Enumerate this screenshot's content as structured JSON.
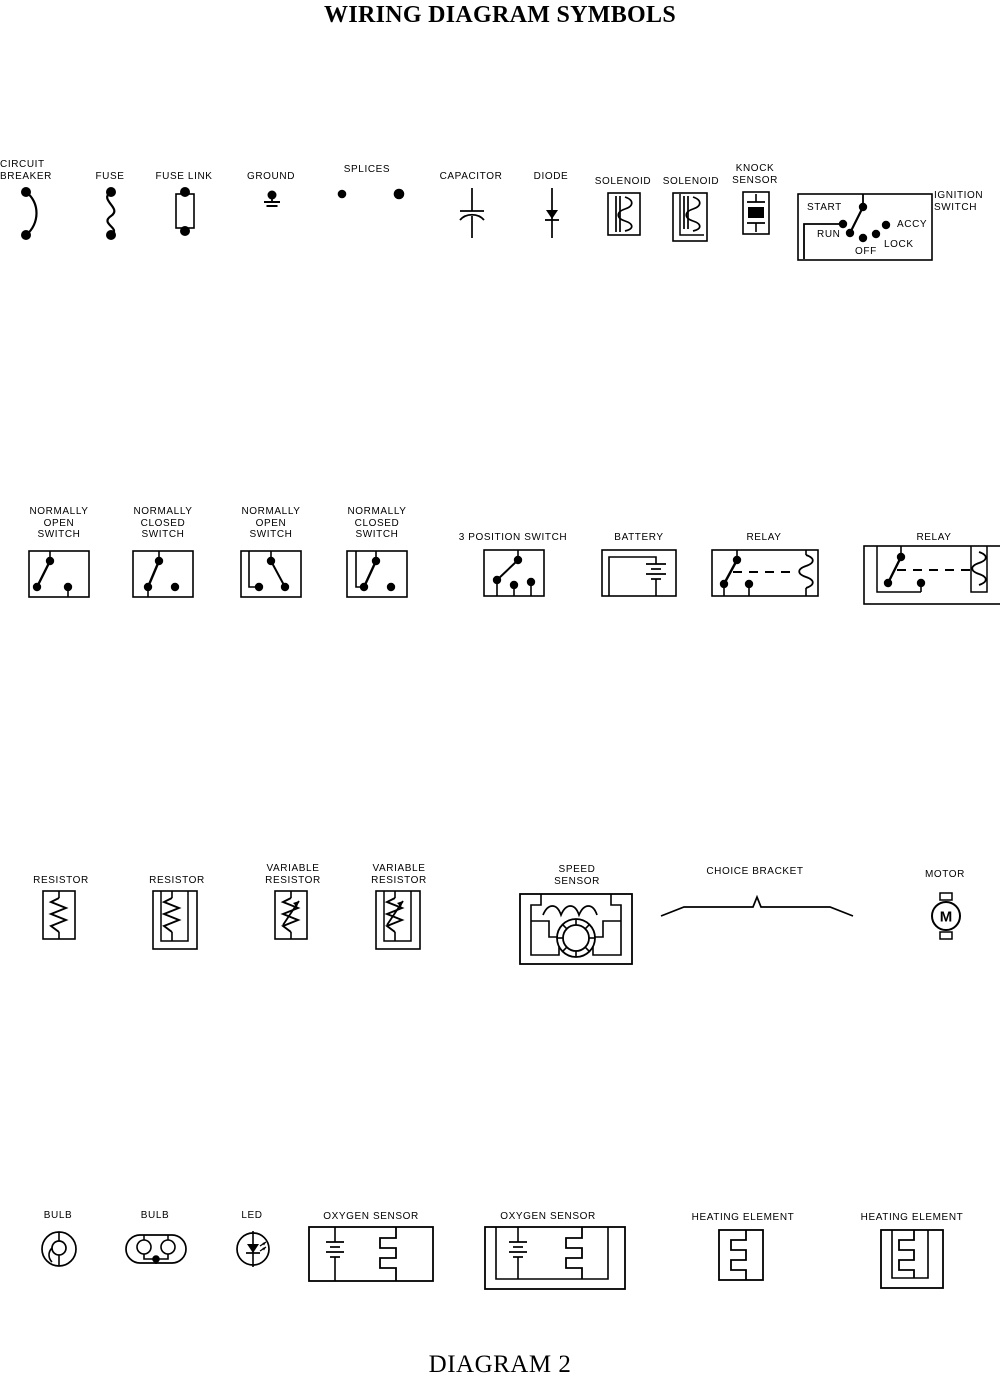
{
  "document": {
    "title": "WIRING DIAGRAM SYMBOLS",
    "footer": "DIAGRAM 2",
    "ink_color": "#000000",
    "background_color": "#ffffff"
  },
  "rows": {
    "row1": {
      "symbols": [
        {
          "name": "circuit-breaker",
          "label": "CIRCUIT\nBREAKER"
        },
        {
          "name": "fuse",
          "label": "FUSE"
        },
        {
          "name": "fuse-link",
          "label": "FUSE LINK"
        },
        {
          "name": "ground",
          "label": "GROUND"
        },
        {
          "name": "splices",
          "label": "SPLICES"
        },
        {
          "name": "capacitor",
          "label": "CAPACITOR"
        },
        {
          "name": "diode",
          "label": "DIODE"
        },
        {
          "name": "solenoid-a",
          "label": "SOLENOID"
        },
        {
          "name": "solenoid-b",
          "label": "SOLENOID"
        },
        {
          "name": "knock-sensor",
          "label": "KNOCK\nSENSOR"
        },
        {
          "name": "ignition-switch",
          "label": "IGNITION\nSWITCH"
        }
      ],
      "ignition_switch_positions": [
        "START",
        "RUN",
        "OFF",
        "LOCK",
        "ACCY"
      ]
    },
    "row2": {
      "symbols": [
        {
          "name": "normally-open-switch-1",
          "label": "NORMALLY\nOPEN\nSWITCH"
        },
        {
          "name": "normally-closed-switch-1",
          "label": "NORMALLY\nCLOSED\nSWITCH"
        },
        {
          "name": "normally-open-switch-2",
          "label": "NORMALLY\nOPEN\nSWITCH"
        },
        {
          "name": "normally-closed-switch-2",
          "label": "NORMALLY\nCLOSED\nSWITCH"
        },
        {
          "name": "three-position-switch",
          "label": "3 POSITION SWITCH"
        },
        {
          "name": "battery",
          "label": "BATTERY"
        },
        {
          "name": "relay-1",
          "label": "RELAY"
        },
        {
          "name": "relay-2",
          "label": "RELAY"
        }
      ]
    },
    "row3": {
      "symbols": [
        {
          "name": "resistor-1",
          "label": "RESISTOR"
        },
        {
          "name": "resistor-2",
          "label": "RESISTOR"
        },
        {
          "name": "variable-resistor-1",
          "label": "VARIABLE\nRESISTOR"
        },
        {
          "name": "variable-resistor-2",
          "label": "VARIABLE\nRESISTOR"
        },
        {
          "name": "speed-sensor",
          "label": "SPEED\nSENSOR"
        },
        {
          "name": "choice-bracket",
          "label": "CHOICE BRACKET"
        },
        {
          "name": "motor",
          "label": "MOTOR",
          "glyph": "M"
        }
      ]
    },
    "row4": {
      "symbols": [
        {
          "name": "bulb-1",
          "label": "BULB"
        },
        {
          "name": "bulb-2",
          "label": "BULB"
        },
        {
          "name": "led",
          "label": "LED"
        },
        {
          "name": "oxygen-sensor-1",
          "label": "OXYGEN SENSOR"
        },
        {
          "name": "oxygen-sensor-2",
          "label": "OXYGEN SENSOR"
        },
        {
          "name": "heating-element-1",
          "label": "HEATING ELEMENT"
        },
        {
          "name": "heating-element-2",
          "label": "HEATING ELEMENT"
        }
      ]
    }
  }
}
